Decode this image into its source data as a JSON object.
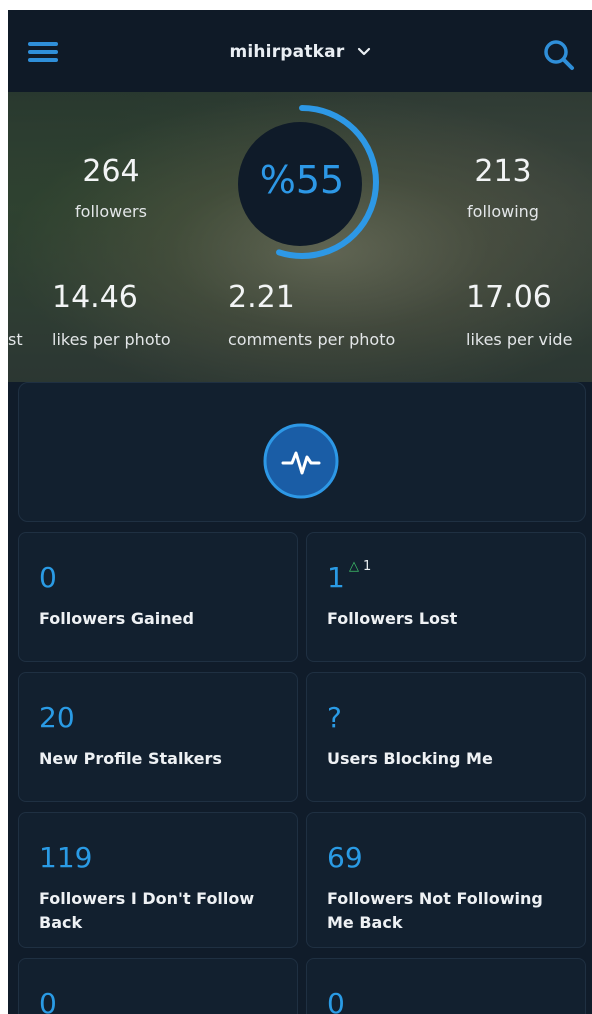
{
  "header": {
    "username": "mihirpatkar",
    "menu_icon": "hamburger-menu-icon",
    "search_icon": "search-icon"
  },
  "hero": {
    "followers": {
      "value": "264",
      "label": "followers"
    },
    "following": {
      "value": "213",
      "label": "following"
    },
    "score": {
      "value": "%55",
      "progress_percent": 55
    },
    "metrics": [
      {
        "value": "",
        "label": "st"
      },
      {
        "value": "14.46",
        "label": "likes per photo"
      },
      {
        "value": "2.21",
        "label": "comments per photo"
      },
      {
        "value": "17.06",
        "label": "likes per vide"
      }
    ]
  },
  "pulse": {
    "icon": "activity-pulse-icon"
  },
  "stats": [
    {
      "value": "0",
      "label": "Followers Gained"
    },
    {
      "value": "1",
      "label": "Followers Lost",
      "delta": "1"
    },
    {
      "value": "20",
      "label": "New Profile Stalkers"
    },
    {
      "value": "?",
      "label": "Users Blocking Me"
    },
    {
      "value": "119",
      "label": "Followers I Don't Follow Back"
    },
    {
      "value": "69",
      "label": "Followers Not Following Me Back"
    },
    {
      "value": "0",
      "label": ""
    },
    {
      "value": "0",
      "label": ""
    }
  ],
  "colors": {
    "accent": "#2a9be5",
    "background": "#101c2a",
    "card": "#12202f",
    "positive": "#3ec16a"
  }
}
